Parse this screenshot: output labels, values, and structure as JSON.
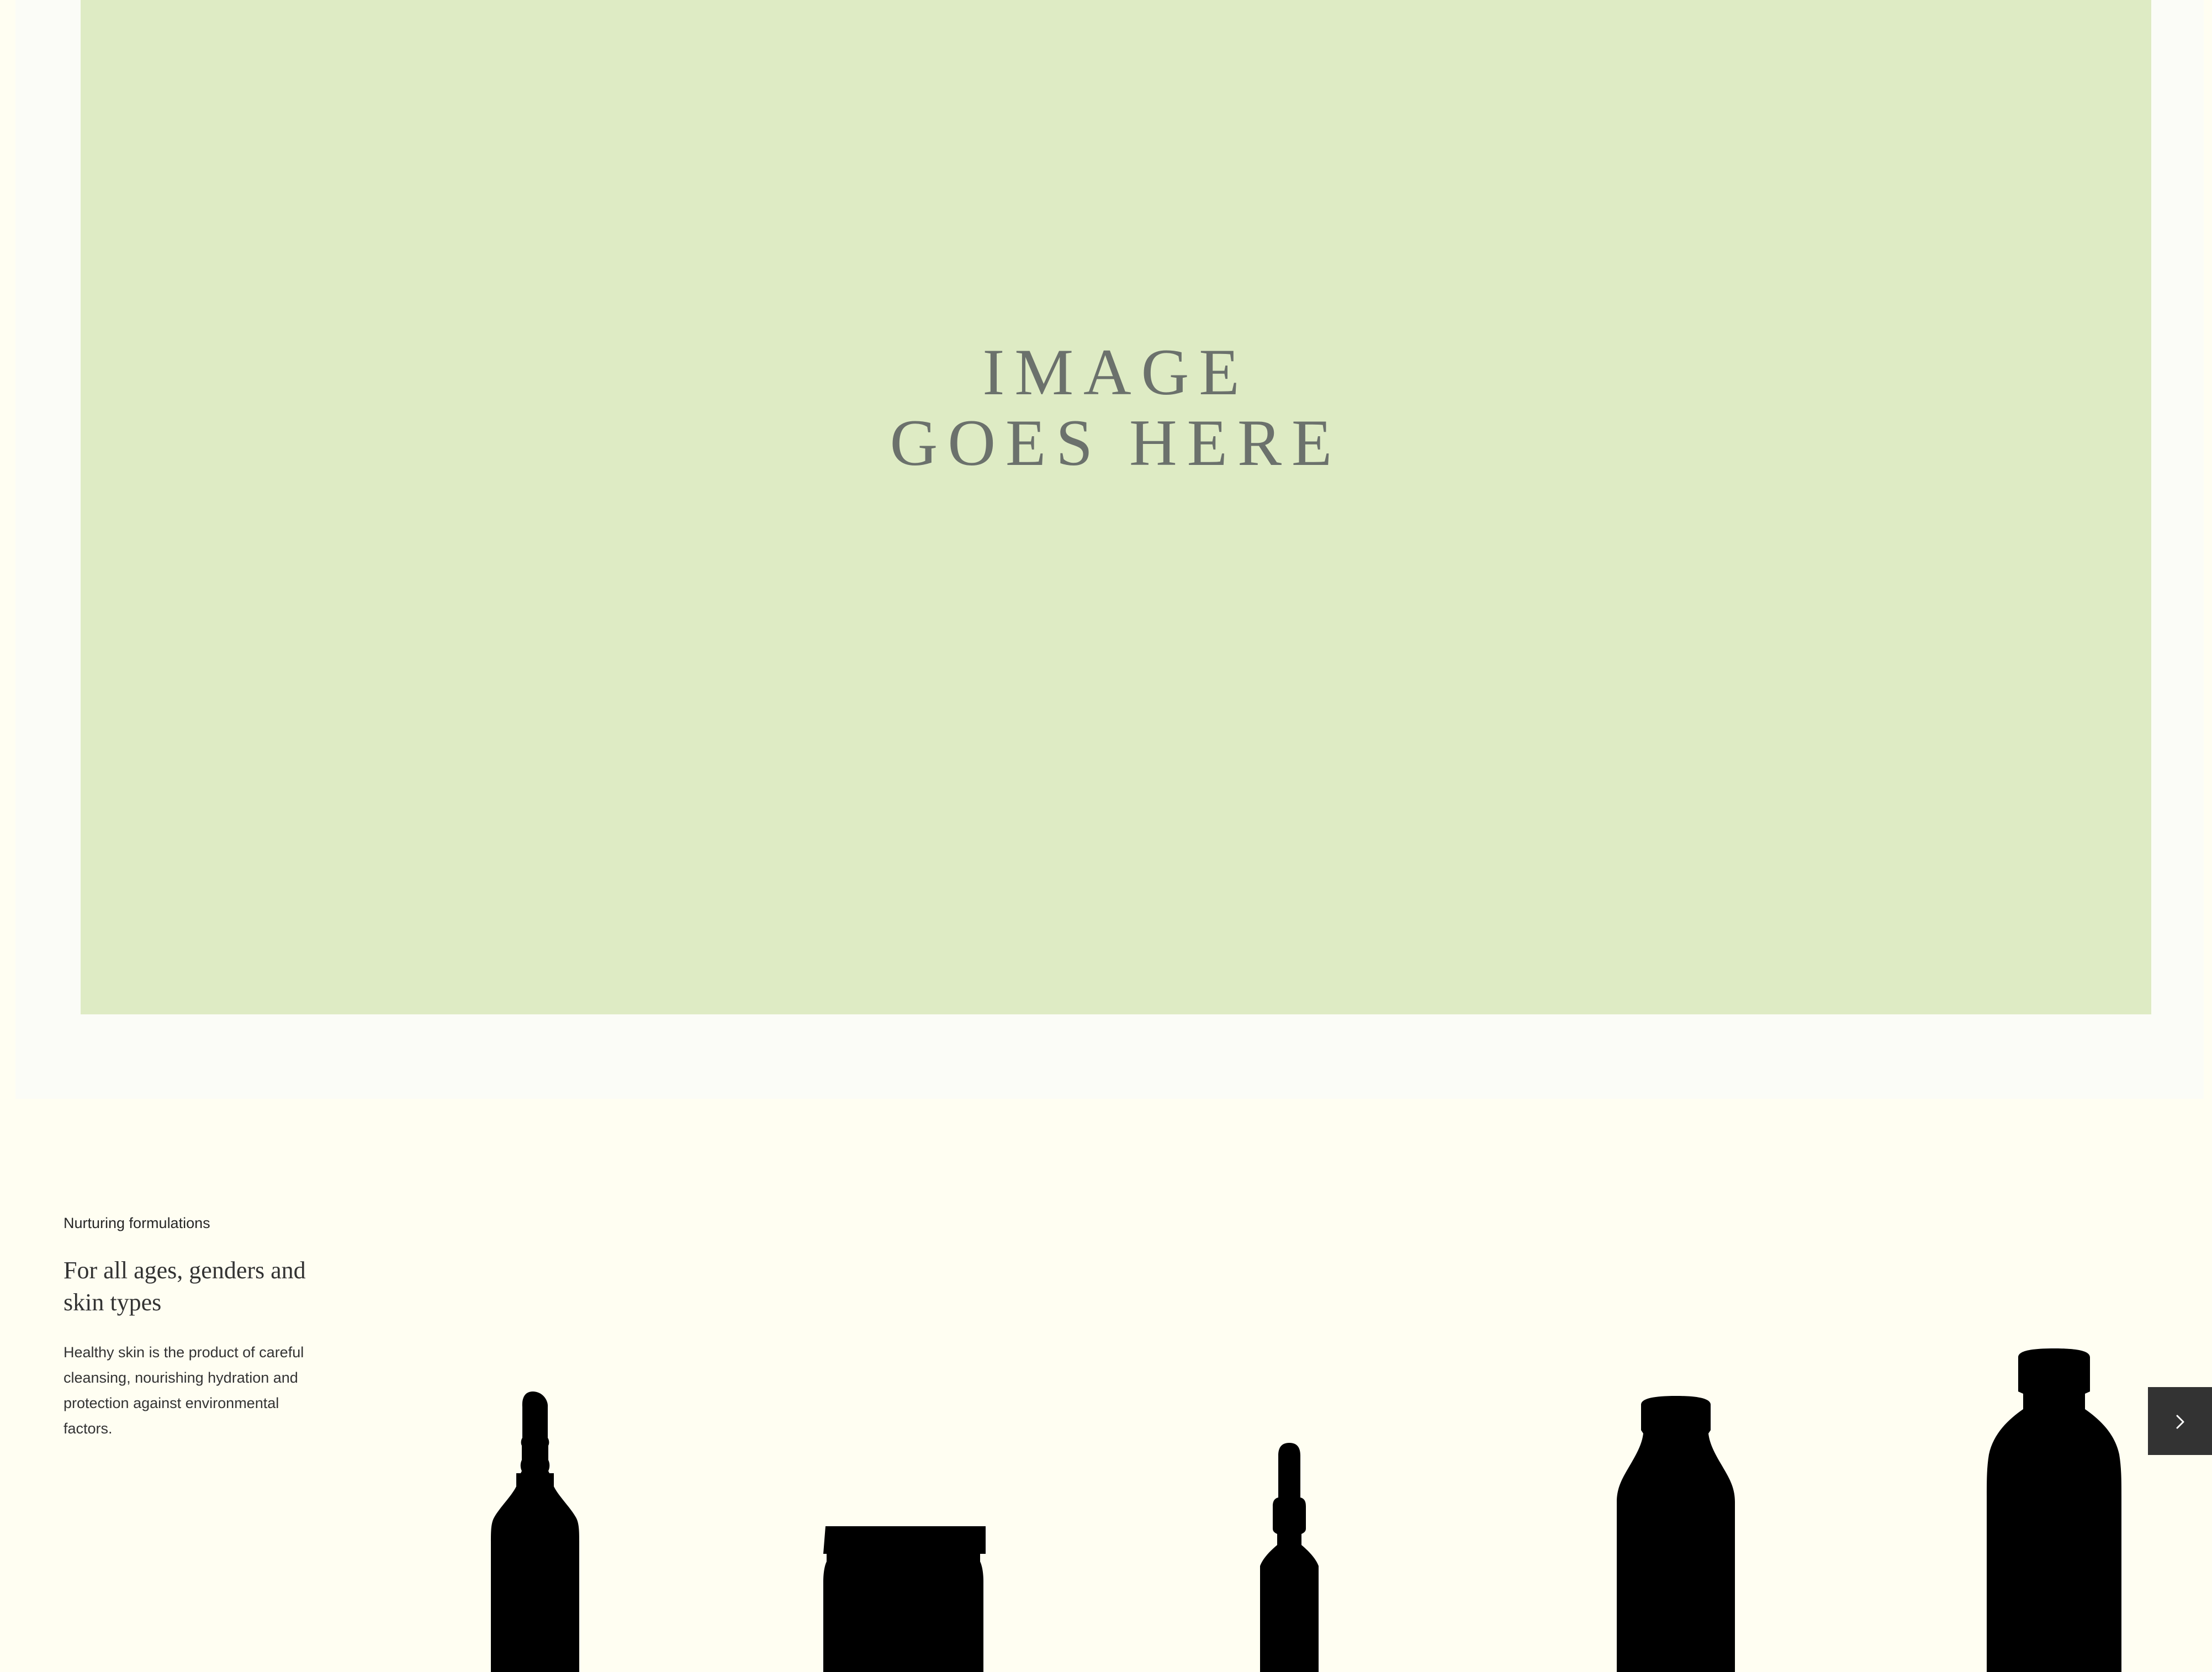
{
  "hero": {
    "placeholder_line1": "IMAGE",
    "placeholder_line2": "GOES HERE",
    "background_color": "#deebc4"
  },
  "section": {
    "eyebrow": "Nurturing formulations",
    "heading": "For all ages, genders and skin types",
    "body": "Healthy skin is the product of careful cleansing, nourishing hydration and protection against environmental factors."
  },
  "carousel": {
    "products": [
      {
        "icon": "dropper-bottle-icon"
      },
      {
        "icon": "jar-icon"
      },
      {
        "icon": "small-dropper-bottle-icon"
      },
      {
        "icon": "tall-bottle-icon"
      },
      {
        "icon": "large-bottle-icon"
      }
    ],
    "next_icon": "chevron-right-icon"
  }
}
